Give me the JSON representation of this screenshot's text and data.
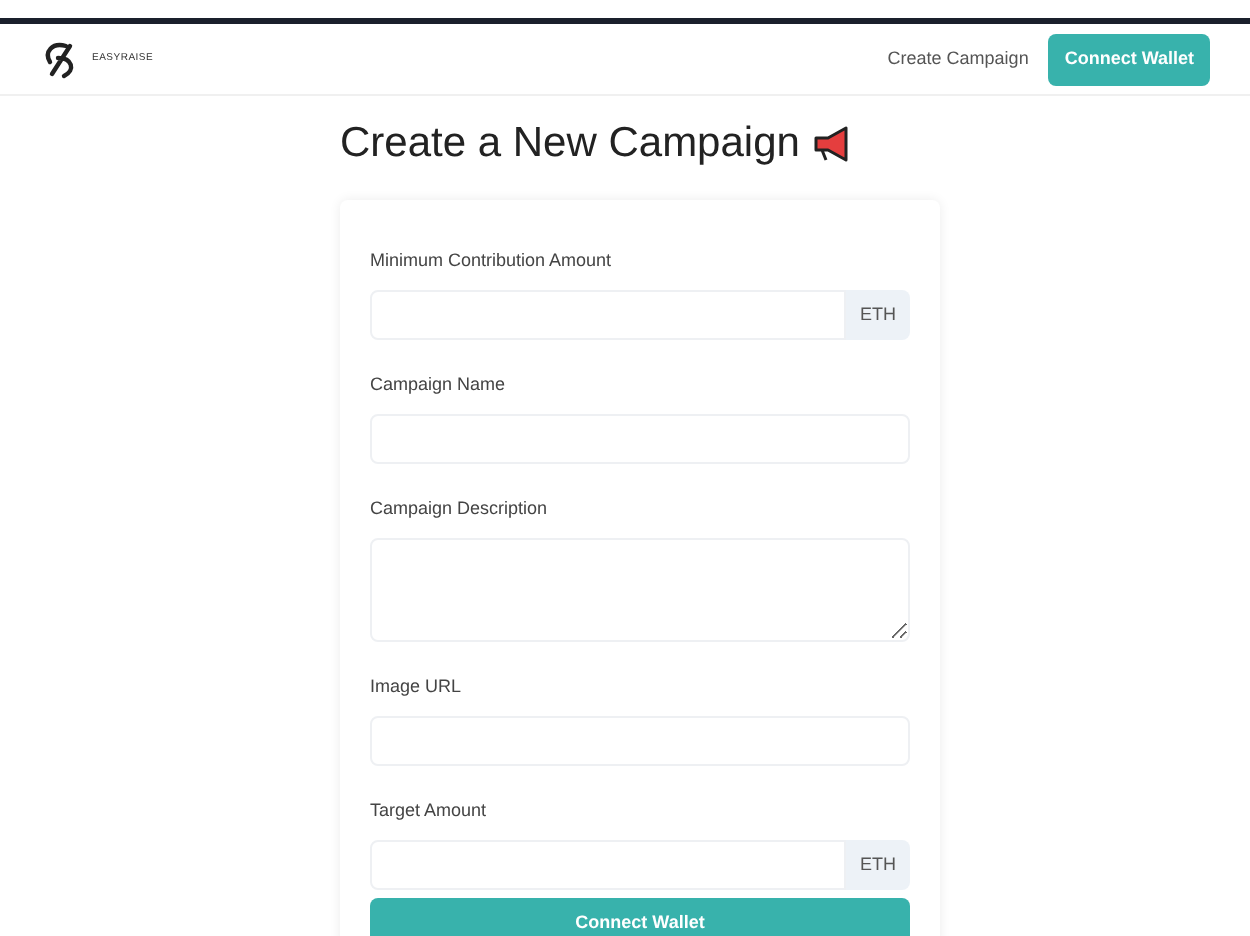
{
  "header": {
    "brand": "EASYRAISE",
    "nav_link": "Create Campaign",
    "wallet_button": "Connect Wallet"
  },
  "title": "Create a New Campaign",
  "form": {
    "fields": [
      {
        "label": "Minimum Contribution Amount",
        "kind": "addon",
        "addon": "ETH"
      },
      {
        "label": "Campaign Name",
        "kind": "text"
      },
      {
        "label": "Campaign Description",
        "kind": "textarea"
      },
      {
        "label": "Image URL",
        "kind": "text"
      },
      {
        "label": "Target Amount",
        "kind": "addon",
        "addon": "ETH"
      }
    ],
    "submit": "Connect Wallet"
  }
}
